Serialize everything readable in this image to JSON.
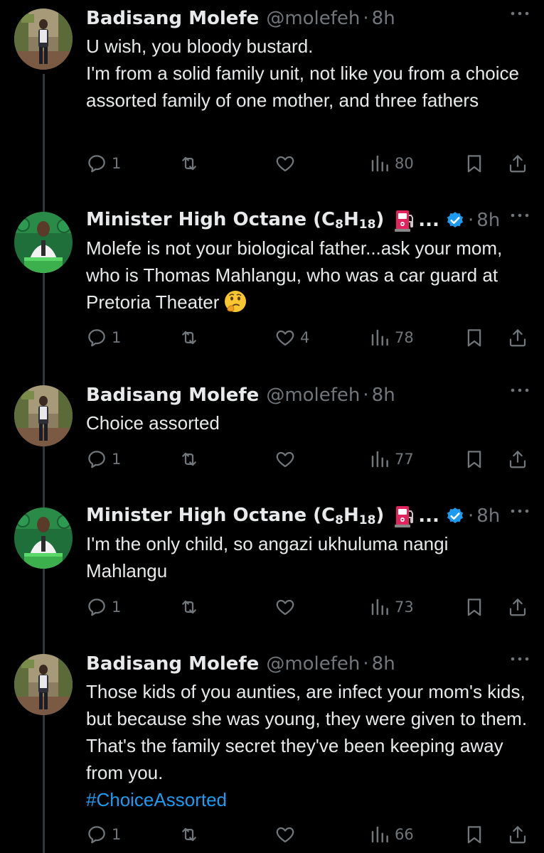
{
  "tweets": [
    {
      "name": "Badisang Molefe",
      "handle": "@molefeh",
      "separator": "·",
      "time": "8h",
      "text": "U wish, you bloody bustard.\nI'm from a solid family unit, not like you from a choice assorted family of one mother, and three fathers",
      "replies": "1",
      "retweets": "",
      "likes": "",
      "views": "80",
      "avatar": "man-standing-outdoors"
    },
    {
      "name_main": "Minister High Octane (C",
      "name_sub1": "8",
      "name_mid": "H",
      "name_sub2": "18",
      "name_end": ")",
      "name_icon": "fuel-pump-icon",
      "name_ellipsis": "...",
      "verified": "verified-badge-icon",
      "separator": "·",
      "time": "8h",
      "text": "Molefe is not your biological father...ask your mom, who is Thomas Mahlangu, who was a car guard at Pretoria Theater",
      "text_emoji": "thinking-face-emoji",
      "replies": "1",
      "retweets": "",
      "likes": "4",
      "views": "78",
      "avatar": "man-at-podium-green"
    },
    {
      "name": "Badisang Molefe",
      "handle": "@molefeh",
      "separator": "·",
      "time": "8h",
      "text": "Choice assorted",
      "replies": "1",
      "retweets": "",
      "likes": "",
      "views": "77",
      "avatar": "man-standing-outdoors"
    },
    {
      "name_main": "Minister High Octane (C",
      "name_sub1": "8",
      "name_mid": "H",
      "name_sub2": "18",
      "name_end": ")",
      "name_icon": "fuel-pump-icon",
      "name_ellipsis": "...",
      "verified": "verified-badge-icon",
      "separator": "·",
      "time": "8h",
      "text": "I'm the only child, so angazi ukhuluma nangi Mahlangu",
      "replies": "1",
      "retweets": "",
      "likes": "",
      "views": "73",
      "avatar": "man-at-podium-green"
    },
    {
      "name": "Badisang Molefe",
      "handle": "@molefeh",
      "separator": "·",
      "time": "8h",
      "text": "Those kids of you aunties, are infect your mom's kids, but because she was young, they were given to them. That's the family secret they've been keeping away from you.",
      "hashtag": "#ChoiceAssorted",
      "replies": "1",
      "retweets": "",
      "likes": "",
      "views": "66",
      "avatar": "man-standing-outdoors"
    }
  ],
  "colors": {
    "background": "#000000",
    "text": "#e7e9ea",
    "secondary": "#71767b",
    "link": "#1d9bf0",
    "verified": "#1d9bf0",
    "thread_line": "#333639",
    "fuel_pump": "#e0245e"
  }
}
